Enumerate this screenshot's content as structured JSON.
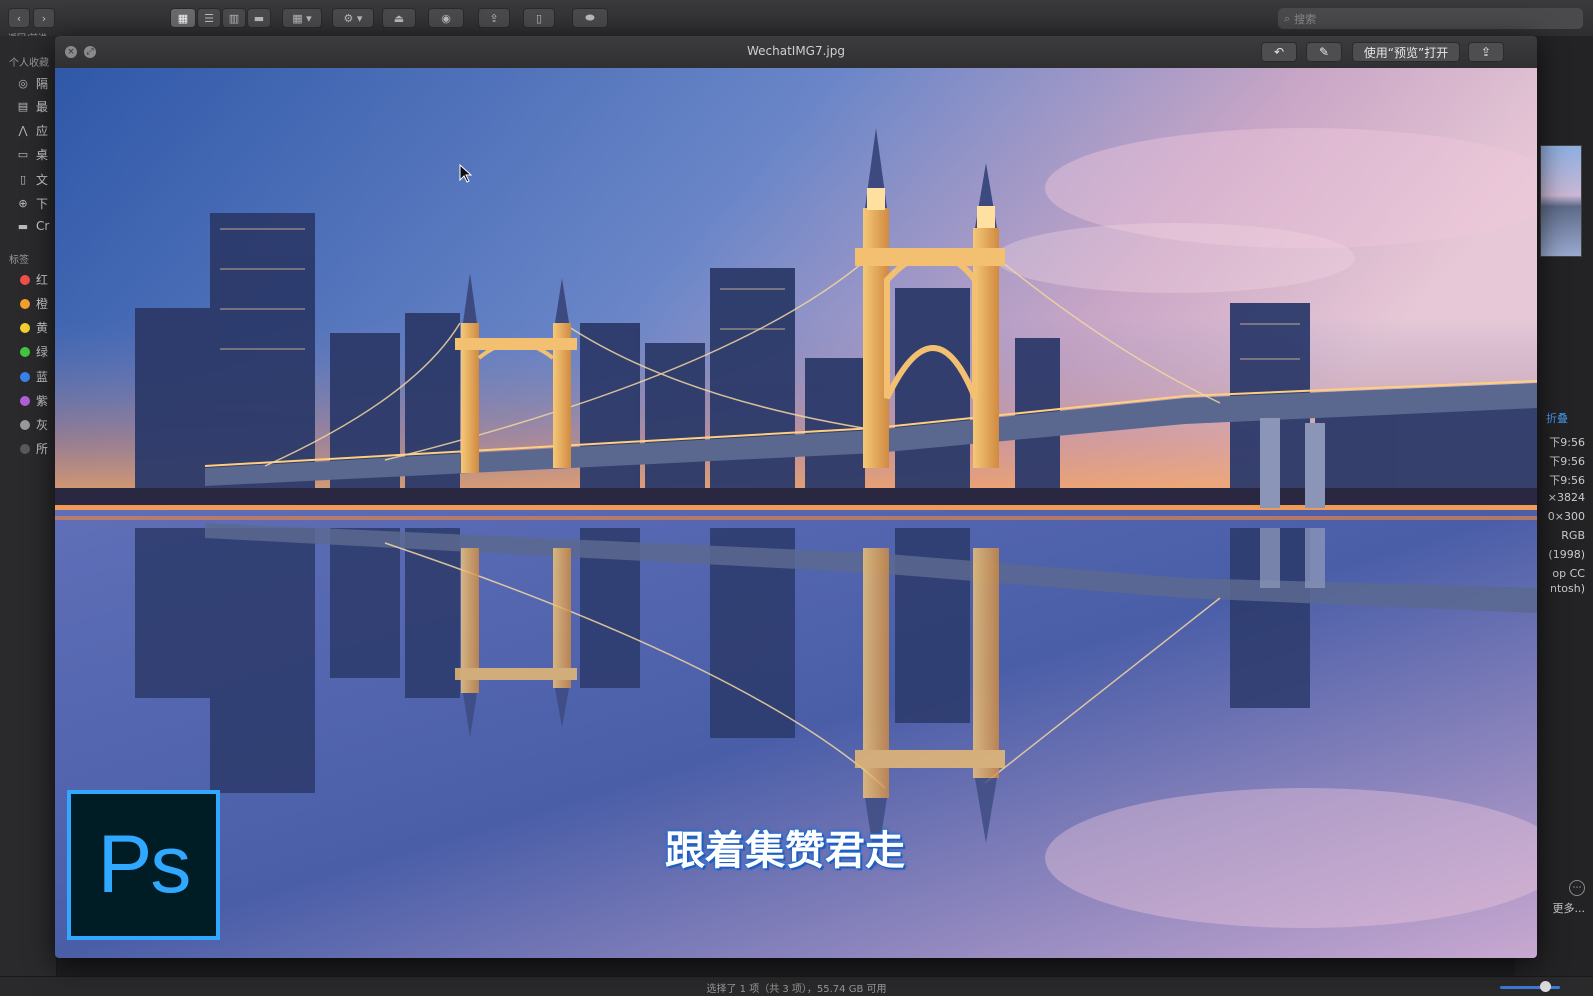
{
  "toolbar": {
    "nav_label": "返回/前进",
    "search_placeholder": "搜索"
  },
  "sidebar": {
    "favorites_header": "个人收藏",
    "favorites": [
      {
        "label": "隔",
        "icon": "airdrop-icon"
      },
      {
        "label": "最",
        "icon": "recents-icon"
      },
      {
        "label": "应",
        "icon": "applications-icon"
      },
      {
        "label": "桌",
        "icon": "desktop-icon"
      },
      {
        "label": "文",
        "icon": "documents-icon"
      },
      {
        "label": "下",
        "icon": "downloads-icon"
      },
      {
        "label": "Cr",
        "icon": "folder-icon"
      }
    ],
    "tags_header": "标签",
    "tags": [
      {
        "label": "红",
        "color": "#f0504a"
      },
      {
        "label": "橙",
        "color": "#f5a030"
      },
      {
        "label": "黄",
        "color": "#f5d030"
      },
      {
        "label": "绿",
        "color": "#40c840"
      },
      {
        "label": "蓝",
        "color": "#3a82f0"
      },
      {
        "label": "紫",
        "color": "#b060d8"
      },
      {
        "label": "灰",
        "color": "#9a9a9a"
      },
      {
        "label": "所",
        "color": "#5a5a5a"
      }
    ]
  },
  "quicklook": {
    "filename": "WechatIMG7.jpg",
    "open_with_label": "使用“预览”打开"
  },
  "overlay": {
    "subtitle": "跟着集赞君走",
    "logo_text": "Ps"
  },
  "info_panel": {
    "fold_label": "折叠",
    "lines": [
      "下9:56",
      "下9:56",
      "下9:56",
      "×3824",
      "0×300",
      "RGB",
      "(1998)",
      "op CC",
      "ntosh)"
    ],
    "more_label": "更多..."
  },
  "statusbar": {
    "text": "选择了 1 项（共 3 项），55.74 GB 可用"
  },
  "colors": {
    "ps_blue": "#31a8ff",
    "ps_bg": "#001d26"
  }
}
